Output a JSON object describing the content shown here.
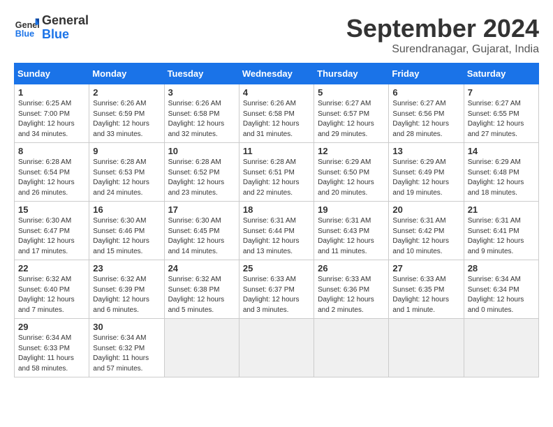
{
  "header": {
    "logo_general": "General",
    "logo_blue": "Blue",
    "month": "September 2024",
    "location": "Surendranagar, Gujarat, India"
  },
  "weekdays": [
    "Sunday",
    "Monday",
    "Tuesday",
    "Wednesday",
    "Thursday",
    "Friday",
    "Saturday"
  ],
  "weeks": [
    [
      {
        "day": 1,
        "sunrise": "6:25 AM",
        "sunset": "7:00 PM",
        "daylight": "12 hours and 34 minutes."
      },
      {
        "day": 2,
        "sunrise": "6:26 AM",
        "sunset": "6:59 PM",
        "daylight": "12 hours and 33 minutes."
      },
      {
        "day": 3,
        "sunrise": "6:26 AM",
        "sunset": "6:58 PM",
        "daylight": "12 hours and 32 minutes."
      },
      {
        "day": 4,
        "sunrise": "6:26 AM",
        "sunset": "6:58 PM",
        "daylight": "12 hours and 31 minutes."
      },
      {
        "day": 5,
        "sunrise": "6:27 AM",
        "sunset": "6:57 PM",
        "daylight": "12 hours and 29 minutes."
      },
      {
        "day": 6,
        "sunrise": "6:27 AM",
        "sunset": "6:56 PM",
        "daylight": "12 hours and 28 minutes."
      },
      {
        "day": 7,
        "sunrise": "6:27 AM",
        "sunset": "6:55 PM",
        "daylight": "12 hours and 27 minutes."
      }
    ],
    [
      {
        "day": 8,
        "sunrise": "6:28 AM",
        "sunset": "6:54 PM",
        "daylight": "12 hours and 26 minutes."
      },
      {
        "day": 9,
        "sunrise": "6:28 AM",
        "sunset": "6:53 PM",
        "daylight": "12 hours and 24 minutes."
      },
      {
        "day": 10,
        "sunrise": "6:28 AM",
        "sunset": "6:52 PM",
        "daylight": "12 hours and 23 minutes."
      },
      {
        "day": 11,
        "sunrise": "6:28 AM",
        "sunset": "6:51 PM",
        "daylight": "12 hours and 22 minutes."
      },
      {
        "day": 12,
        "sunrise": "6:29 AM",
        "sunset": "6:50 PM",
        "daylight": "12 hours and 20 minutes."
      },
      {
        "day": 13,
        "sunrise": "6:29 AM",
        "sunset": "6:49 PM",
        "daylight": "12 hours and 19 minutes."
      },
      {
        "day": 14,
        "sunrise": "6:29 AM",
        "sunset": "6:48 PM",
        "daylight": "12 hours and 18 minutes."
      }
    ],
    [
      {
        "day": 15,
        "sunrise": "6:30 AM",
        "sunset": "6:47 PM",
        "daylight": "12 hours and 17 minutes."
      },
      {
        "day": 16,
        "sunrise": "6:30 AM",
        "sunset": "6:46 PM",
        "daylight": "12 hours and 15 minutes."
      },
      {
        "day": 17,
        "sunrise": "6:30 AM",
        "sunset": "6:45 PM",
        "daylight": "12 hours and 14 minutes."
      },
      {
        "day": 18,
        "sunrise": "6:31 AM",
        "sunset": "6:44 PM",
        "daylight": "12 hours and 13 minutes."
      },
      {
        "day": 19,
        "sunrise": "6:31 AM",
        "sunset": "6:43 PM",
        "daylight": "12 hours and 11 minutes."
      },
      {
        "day": 20,
        "sunrise": "6:31 AM",
        "sunset": "6:42 PM",
        "daylight": "12 hours and 10 minutes."
      },
      {
        "day": 21,
        "sunrise": "6:31 AM",
        "sunset": "6:41 PM",
        "daylight": "12 hours and 9 minutes."
      }
    ],
    [
      {
        "day": 22,
        "sunrise": "6:32 AM",
        "sunset": "6:40 PM",
        "daylight": "12 hours and 7 minutes."
      },
      {
        "day": 23,
        "sunrise": "6:32 AM",
        "sunset": "6:39 PM",
        "daylight": "12 hours and 6 minutes."
      },
      {
        "day": 24,
        "sunrise": "6:32 AM",
        "sunset": "6:38 PM",
        "daylight": "12 hours and 5 minutes."
      },
      {
        "day": 25,
        "sunrise": "6:33 AM",
        "sunset": "6:37 PM",
        "daylight": "12 hours and 3 minutes."
      },
      {
        "day": 26,
        "sunrise": "6:33 AM",
        "sunset": "6:36 PM",
        "daylight": "12 hours and 2 minutes."
      },
      {
        "day": 27,
        "sunrise": "6:33 AM",
        "sunset": "6:35 PM",
        "daylight": "12 hours and 1 minute."
      },
      {
        "day": 28,
        "sunrise": "6:34 AM",
        "sunset": "6:34 PM",
        "daylight": "12 hours and 0 minutes."
      }
    ],
    [
      {
        "day": 29,
        "sunrise": "6:34 AM",
        "sunset": "6:33 PM",
        "daylight": "11 hours and 58 minutes."
      },
      {
        "day": 30,
        "sunrise": "6:34 AM",
        "sunset": "6:32 PM",
        "daylight": "11 hours and 57 minutes."
      },
      null,
      null,
      null,
      null,
      null
    ]
  ]
}
